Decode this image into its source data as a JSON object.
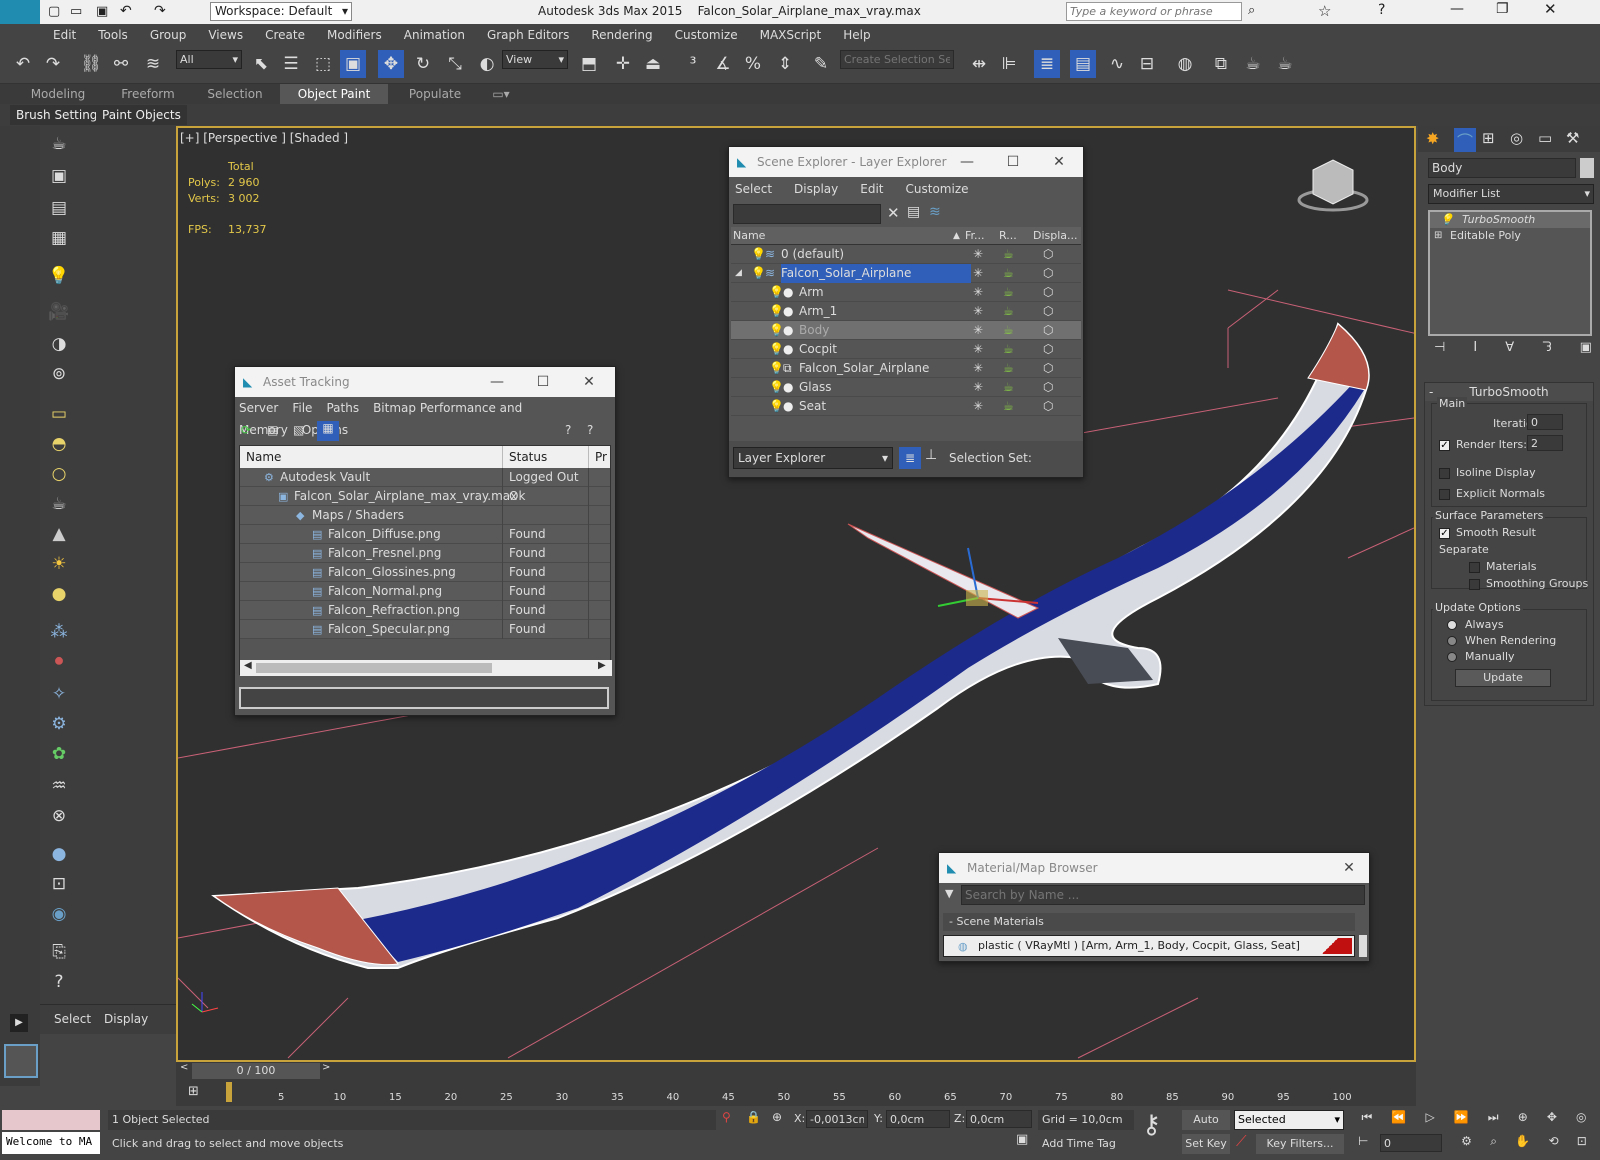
{
  "app": {
    "title": "Autodesk 3ds Max  2015",
    "file": "Falcon_Solar_Airplane_max_vray.max",
    "workspace": "Workspace: Default",
    "search_placeholder": "Type a keyword or phrase",
    "logo": "MAX"
  },
  "menu": [
    "Edit",
    "Tools",
    "Group",
    "Views",
    "Create",
    "Modifiers",
    "Animation",
    "Graph Editors",
    "Rendering",
    "Customize",
    "MAXScript",
    "Help"
  ],
  "toolbar": {
    "filter": "All",
    "refcoord": "View",
    "selection_set_placeholder": "Create Selection Se"
  },
  "ribbon": {
    "tabs": [
      "Modeling",
      "Freeform",
      "Selection",
      "Object Paint",
      "Populate"
    ],
    "active": "Object Paint",
    "sub": [
      "Brush Settings",
      "Paint Objects"
    ]
  },
  "viewport": {
    "label": "[+] [Perspective ] [Shaded ]",
    "stats": {
      "header": "Total",
      "polys_label": "Polys:",
      "polys": "2 960",
      "verts_label": "Verts:",
      "verts": "3 002",
      "fps_label": "FPS:",
      "fps": "13,737"
    }
  },
  "scene_explorer": {
    "title": "Scene Explorer - Layer Explorer",
    "menu": [
      "Select",
      "Display",
      "Edit",
      "Customize"
    ],
    "columns": [
      "Name",
      "Fr...",
      "R...",
      "Displa..."
    ],
    "rows": [
      {
        "name": "0 (default)",
        "level": 0,
        "kind": "layer"
      },
      {
        "name": "Falcon_Solar_Airplane",
        "level": 0,
        "kind": "layer",
        "selected": true
      },
      {
        "name": "Arm",
        "level": 1,
        "kind": "object"
      },
      {
        "name": "Arm_1",
        "level": 1,
        "kind": "object"
      },
      {
        "name": "Body",
        "level": 1,
        "kind": "object",
        "highlight": true
      },
      {
        "name": "Cocpit",
        "level": 1,
        "kind": "object"
      },
      {
        "name": "Falcon_Solar_Airplane",
        "level": 1,
        "kind": "group"
      },
      {
        "name": "Glass",
        "level": 1,
        "kind": "object"
      },
      {
        "name": "Seat",
        "level": 1,
        "kind": "object"
      }
    ],
    "footer_mode": "Layer Explorer",
    "selection_set_label": "Selection Set:"
  },
  "asset_tracking": {
    "title": "Asset Tracking",
    "menu": [
      "Server",
      "File",
      "Paths",
      "Bitmap Performance and Memory",
      "Options"
    ],
    "columns": [
      "Name",
      "Status",
      "Pr"
    ],
    "rows": [
      {
        "name": "Autodesk Vault",
        "status": "Logged Out ...",
        "level": 0
      },
      {
        "name": "Falcon_Solar_Airplane_max_vray.max",
        "status": "Ok",
        "level": 1
      },
      {
        "name": "Maps / Shaders",
        "status": "",
        "level": 2
      },
      {
        "name": "Falcon_Diffuse.png",
        "status": "Found",
        "level": 3
      },
      {
        "name": "Falcon_Fresnel.png",
        "status": "Found",
        "level": 3
      },
      {
        "name": "Falcon_Glossines.png",
        "status": "Found",
        "level": 3
      },
      {
        "name": "Falcon_Normal.png",
        "status": "Found",
        "level": 3
      },
      {
        "name": "Falcon_Refraction.png",
        "status": "Found",
        "level": 3
      },
      {
        "name": "Falcon_Specular.png",
        "status": "Found",
        "level": 3
      }
    ]
  },
  "material_browser": {
    "title": "Material/Map Browser",
    "search_placeholder": "Search by Name ...",
    "group": "- Scene Materials",
    "item": "plastic  ( VRayMtl )  [Arm, Arm_1, Body, Cocpit, Glass, Seat]"
  },
  "modify_panel": {
    "object_name": "Body",
    "modifier_list": "Modifier List",
    "stack": [
      "TurboSmooth",
      "Editable Poly"
    ],
    "rollout_title": "TurboSmooth",
    "main_label": "Main",
    "iterations_label": "Iterations:",
    "iterations": "0",
    "render_iters_label": "Render Iters:",
    "render_iters": "2",
    "isoline": "Isoline Display",
    "explicit_normals": "Explicit Normals",
    "surface_params": "Surface Parameters",
    "smooth_result": "Smooth Result",
    "separate": "Separate",
    "materials": "Materials",
    "smoothing_groups": "Smoothing Groups",
    "update_options": "Update Options",
    "always": "Always",
    "when_rendering": "When Rendering",
    "manually": "Manually",
    "update_btn": "Update"
  },
  "command_panel": {
    "select": "Select",
    "display": "Display"
  },
  "timeline": {
    "frame": "0 / 100",
    "ticks": [
      "5",
      "10",
      "15",
      "20",
      "25",
      "30",
      "35",
      "40",
      "45",
      "50",
      "55",
      "60",
      "65",
      "70",
      "75",
      "80",
      "85",
      "90",
      "95",
      "100"
    ]
  },
  "status": {
    "selected": "1 Object Selected",
    "prompt": "Click and drag to select and move objects",
    "maxscript": "Welcome to MA",
    "x_label": "X:",
    "x": "-0,0013cm",
    "y_label": "Y:",
    "y": "0,0cm",
    "z_label": "Z:",
    "z": "0,0cm",
    "grid": "Grid = 10,0cm",
    "add_time_tag": "Add Time Tag",
    "auto_key": "Auto Key",
    "set_key": "Set Key",
    "key_mode": "Selected",
    "key_filters": "Key Filters...",
    "frame_field": "0"
  },
  "colors": {
    "accent": "#c8a23a",
    "wing_blue": "#1c2a8c",
    "wing_tip": "#b5564a",
    "selection": "#2f5fb8"
  }
}
